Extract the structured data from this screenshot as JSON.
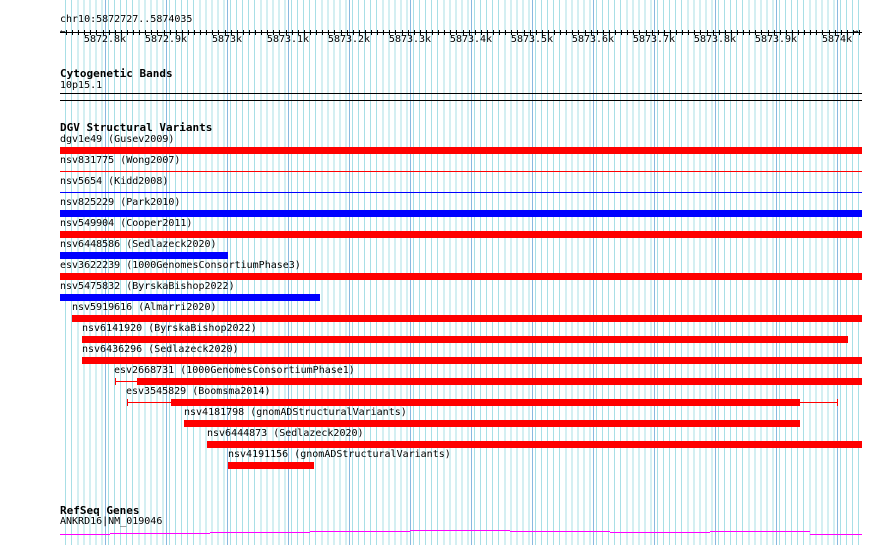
{
  "ruler": {
    "location": "chr10:5872727..5874035",
    "ticks": [
      "5872.8k",
      "5872.9k",
      "5873k",
      "5873.1k",
      "5873.2k",
      "5873.3k",
      "5873.4k",
      "5873.5k",
      "5873.6k",
      "5873.7k",
      "5873.8k",
      "5873.9k",
      "5874k"
    ]
  },
  "cytobands": {
    "title": "Cytogenetic Bands",
    "band": "10p15.1"
  },
  "dgv": {
    "title": "DGV Structural Variants",
    "features": [
      {
        "label": "dgv1e49 (Gusev2009)",
        "color": "#ff0000"
      },
      {
        "label": "nsv831775 (Wong2007)",
        "color": "#ff0000"
      },
      {
        "label": "nsv5654 (Kidd2008)",
        "color": "#0000ff"
      },
      {
        "label": "nsv825229 (Park2010)",
        "color": "#0000ff"
      },
      {
        "label": "nsv549904 (Cooper2011)",
        "color": "#ff0000"
      },
      {
        "label": "nsv6448586 (Sedlazeck2020)",
        "color": "#0000ff"
      },
      {
        "label": "esv3622239 (1000GenomesConsortiumPhase3)",
        "color": "#ff0000"
      },
      {
        "label": "nsv5475832 (ByrskaBishop2022)",
        "color": "#0000ff"
      },
      {
        "label": "nsv5919616 (Almarri2020)",
        "color": "#ff0000"
      },
      {
        "label": "nsv6141920 (ByrskaBishop2022)",
        "color": "#ff0000"
      },
      {
        "label": "nsv6436296 (Sedlazeck2020)",
        "color": "#ff0000"
      },
      {
        "label": "esv2668731 (1000GenomesConsortiumPhase1)",
        "color": "#ff0000"
      },
      {
        "label": "esv3545829 (Boomsma2014)",
        "color": "#ff0000"
      },
      {
        "label": "nsv4181798 (gnomADStructuralVariants)",
        "color": "#ff0000"
      },
      {
        "label": "nsv6444873 (Sedlazeck2020)",
        "color": "#ff0000"
      },
      {
        "label": "nsv4191156 (gnomADStructuralVariants)",
        "color": "#ff0000"
      }
    ]
  },
  "refseq": {
    "title": "RefSeq Genes",
    "gene": "ANKRD16|NM_019046"
  }
}
